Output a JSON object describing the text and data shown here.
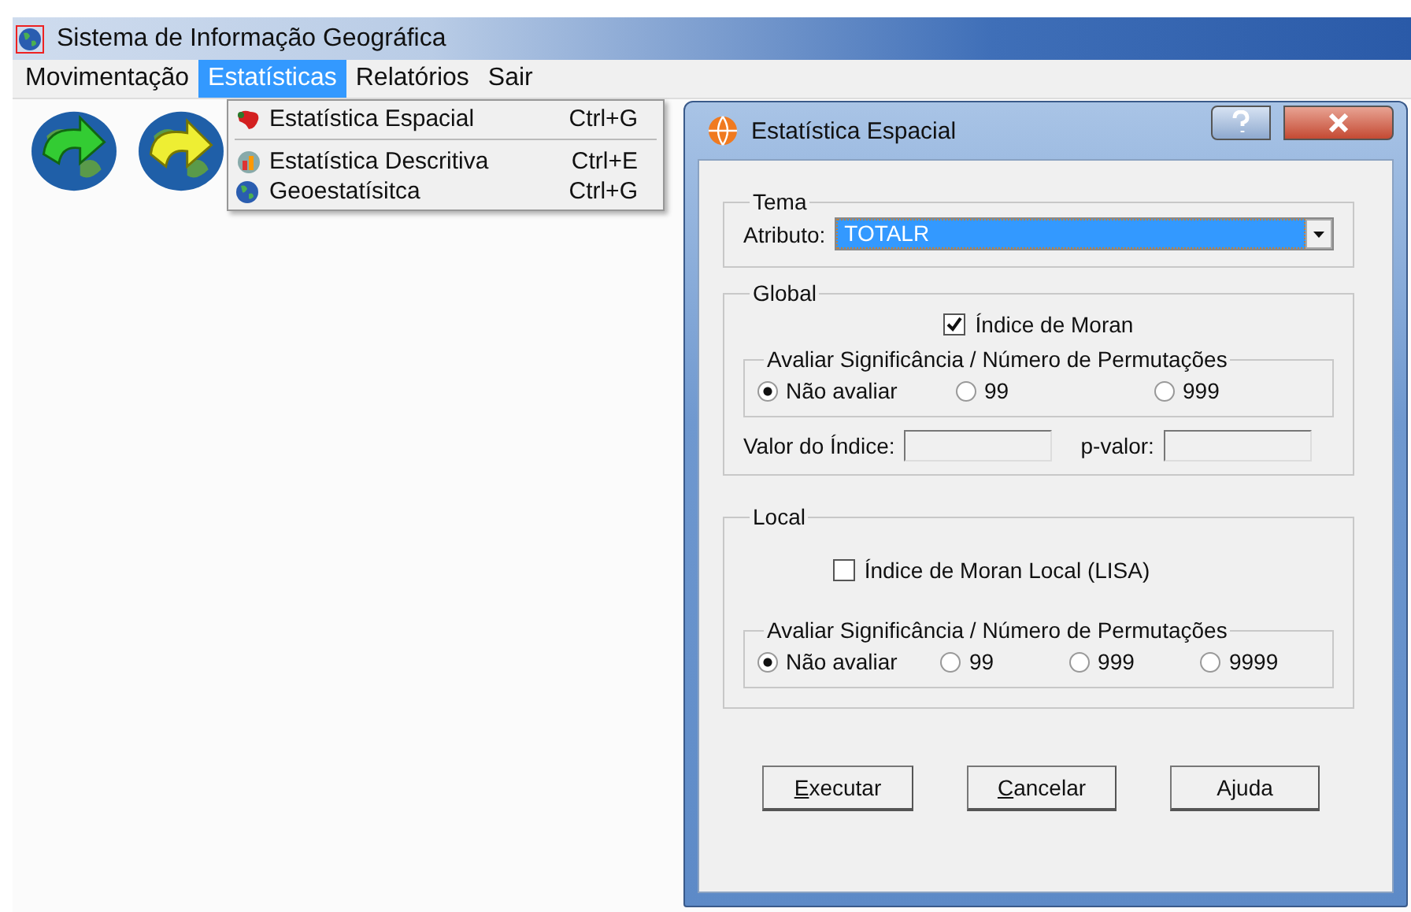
{
  "window": {
    "title": "Sistema de Informação Geográfica"
  },
  "menu": [
    {
      "label": "Movimentação",
      "selected": false
    },
    {
      "label": "Estatísticas",
      "selected": true
    },
    {
      "label": "Relatórios",
      "selected": false
    },
    {
      "label": "Sair",
      "selected": false
    }
  ],
  "dropdown": [
    {
      "kind": "item",
      "label": "Estatística Espacial",
      "shortcut": "Ctrl+G"
    },
    {
      "kind": "separator"
    },
    {
      "kind": "item",
      "label": "Estatística Descritiva",
      "shortcut": "Ctrl+E"
    },
    {
      "kind": "item",
      "label": "Geoestatísitca",
      "shortcut": "Ctrl+G"
    }
  ],
  "toolbar": [
    {
      "kind": "down"
    },
    {
      "kind": "up"
    }
  ],
  "dialog": {
    "title": "Estatística Espacial",
    "tema": {
      "legend": "Tema",
      "label": "Atributo:",
      "value": "TOTALR"
    },
    "global": {
      "legend": "Global",
      "checkbox": {
        "label": "Índice de Moran",
        "checked": true
      },
      "group": {
        "legend": "Avaliar Significância / Número de Permutações",
        "options": [
          {
            "label": "Não avaliar",
            "selected": true
          },
          {
            "label": "99",
            "selected": false
          },
          {
            "label": "999",
            "selected": false
          }
        ]
      },
      "fields": [
        {
          "label": "Valor do Índice:"
        },
        {
          "label": "p-valor:"
        }
      ]
    },
    "local": {
      "legend": "Local",
      "checkbox": {
        "label": "Índice de Moran Local (LISA)",
        "checked": false
      },
      "group": {
        "legend": "Avaliar Significância / Número de Permutações",
        "options": [
          {
            "label": "Não avaliar",
            "selected": true
          },
          {
            "label": "99",
            "selected": false
          },
          {
            "label": "999",
            "selected": false
          },
          {
            "label": "9999",
            "selected": false
          }
        ]
      }
    },
    "buttons": [
      {
        "label": "Executar",
        "underline_first": true
      },
      {
        "label": "Cancelar",
        "underline_first": true
      },
      {
        "label": "Ajuda",
        "underline_first": false
      }
    ]
  }
}
